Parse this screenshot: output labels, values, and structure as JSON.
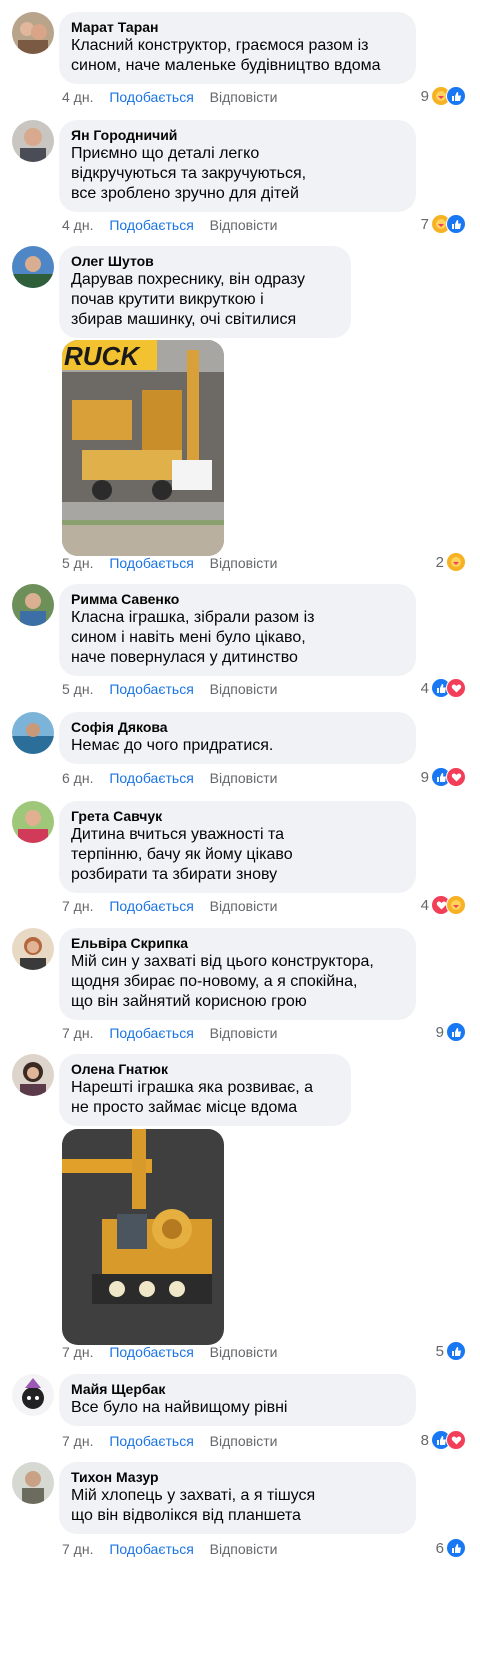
{
  "actions": {
    "like": "Подобається",
    "reply": "Відповісти"
  },
  "comments": [
    {
      "author": "Марат Таран",
      "text": "Класний конструктор, граємося разом із\nсином, наче маленьке будівництво вдома",
      "time": "4 дн.",
      "count": "9",
      "reactions": [
        "care",
        "like"
      ]
    },
    {
      "author": "Ян Городничий",
      "text": "Приємно що деталі легко\nвідкручуються та закручуються,\nвсе зроблено зручно для дітей",
      "time": "4 дн.",
      "count": "7",
      "reactions": [
        "care",
        "like"
      ]
    },
    {
      "author": "Олег Шутов",
      "text": "Дарував похреснику, він одразу\nпочав крутити викруткою і\nзбирав машинку, очі світилися",
      "time": "5 дн.",
      "count": "2",
      "reactions": [
        "care"
      ],
      "photo_text": "RUCK"
    },
    {
      "author": "Римма Савенко",
      "text": "Класна іграшка, зібрали разом із\nсином і навіть мені було цікаво,\nначе повернулася у дитинство",
      "time": "5 дн.",
      "count": "4",
      "reactions": [
        "like",
        "love"
      ]
    },
    {
      "author": "Софія Дякова",
      "text": "Немає до чого придратися.",
      "time": "6 дн.",
      "count": "9",
      "reactions": [
        "like",
        "love"
      ]
    },
    {
      "author": "Грета Савчук",
      "text": "Дитина вчиться уважності та\nтерпінню, бачу як йому цікаво\nрозбирати та збирати знову",
      "time": "7 дн.",
      "count": "4",
      "reactions": [
        "love",
        "care"
      ]
    },
    {
      "author": "Ельвіра Скрипка",
      "text": "Мій син у захваті від цього конструктора,\nщодня збирає по-новому, а я спокійна,\nщо він зайнятий корисною грою",
      "time": "7 дн.",
      "count": "9",
      "reactions": [
        "like"
      ]
    },
    {
      "author": "Олена Гнатюк",
      "text": "Нарешті іграшка яка розвиває, а\nне просто займає місце вдома",
      "time": "7 дн.",
      "count": "5",
      "reactions": [
        "like"
      ]
    },
    {
      "author": "Майя Щербак",
      "text": "Все було на найвищому рівні",
      "time": "7 дн.",
      "count": "8",
      "reactions": [
        "like",
        "love"
      ]
    },
    {
      "author": "Тихон Мазур",
      "text": "Мій хлопець у захваті, а я тішуся\nщо він відволікся від планшета",
      "time": "7 дн.",
      "count": "6",
      "reactions": [
        "like"
      ]
    }
  ]
}
